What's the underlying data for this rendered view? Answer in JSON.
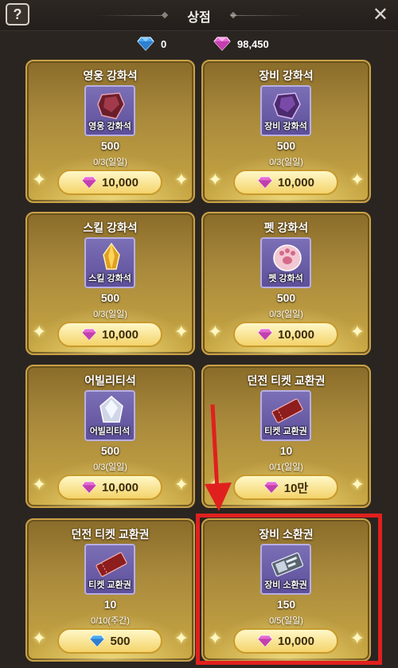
{
  "header": {
    "help_label": "?",
    "title": "상점",
    "close_label": "✕"
  },
  "currencies": {
    "diamond": "0",
    "gem": "98,450"
  },
  "items": [
    {
      "title": "영웅 강화석",
      "label": "영웅 강화석",
      "qty": "500",
      "limit": "0/3(일일)",
      "price": "10,000",
      "currency": "gem"
    },
    {
      "title": "장비 강화석",
      "label": "장비 강화석",
      "qty": "500",
      "limit": "0/3(일일)",
      "price": "10,000",
      "currency": "gem"
    },
    {
      "title": "스킬 강화석",
      "label": "스킬 강화석",
      "qty": "500",
      "limit": "0/3(일일)",
      "price": "10,000",
      "currency": "gem"
    },
    {
      "title": "펫 강화석",
      "label": "펫 강화석",
      "qty": "500",
      "limit": "0/3(일일)",
      "price": "10,000",
      "currency": "gem"
    },
    {
      "title": "어빌리티석",
      "label": "어빌리티석",
      "qty": "500",
      "limit": "0/3(일일)",
      "price": "10,000",
      "currency": "gem"
    },
    {
      "title": "던전 티켓 교환권",
      "label": "티켓 교환권",
      "qty": "10",
      "limit": "0/1(일일)",
      "price": "10만",
      "currency": "gem"
    },
    {
      "title": "던전 티켓 교환권",
      "label": "티켓 교환권",
      "qty": "10",
      "limit": "0/10(주간)",
      "price": "500",
      "currency": "diamond"
    },
    {
      "title": "장비 소환권",
      "label": "장비 소환권",
      "qty": "150",
      "limit": "0/5(일일)",
      "price": "10,000",
      "currency": "gem"
    }
  ],
  "colors": {
    "accent_red": "#e0201e",
    "gem_pink": "#e46bd0",
    "diamond_blue": "#4aa8f0"
  }
}
